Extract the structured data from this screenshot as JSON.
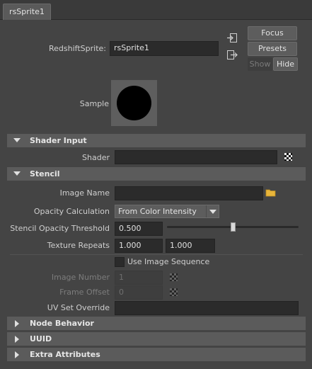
{
  "tab": {
    "label": "rsSprite1"
  },
  "header": {
    "node_type_label": "RedshiftSprite:",
    "node_name": "rsSprite1",
    "focus_label": "Focus",
    "presets_label": "Presets",
    "show_label": "Show",
    "hide_label": "Hide",
    "sample_label": "Sample"
  },
  "sections": {
    "shader_input": {
      "title": "Shader Input",
      "shader_label": "Shader",
      "shader_value": ""
    },
    "stencil": {
      "title": "Stencil",
      "image_name_label": "Image Name",
      "image_name_value": "",
      "opacity_calc_label": "Opacity Calculation",
      "opacity_calc_value": "From Color Intensity",
      "threshold_label": "Stencil Opacity Threshold",
      "threshold_value": "0.500",
      "threshold_slider_fraction": 0.5,
      "texture_repeats_label": "Texture Repeats",
      "texture_repeats_u": "1.000",
      "texture_repeats_v": "1.000",
      "use_image_sequence_label": "Use Image Sequence",
      "image_number_label": "Image Number",
      "image_number_value": "1",
      "frame_offset_label": "Frame Offset",
      "frame_offset_value": "0",
      "uv_set_override_label": "UV Set Override",
      "uv_set_override_value": ""
    },
    "node_behavior": {
      "title": "Node Behavior"
    },
    "uuid": {
      "title": "UUID"
    },
    "extra_attributes": {
      "title": "Extra Attributes"
    }
  }
}
